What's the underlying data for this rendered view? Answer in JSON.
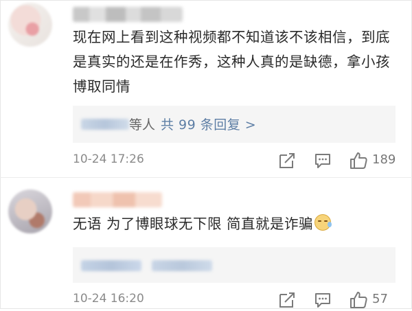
{
  "comments": [
    {
      "text": "现在网上看到这种视频都不知道该不该相信，到底是真实的还是在作秀，这种人真的是缺德，拿小孩博取同情",
      "reply_suffix": "等人",
      "reply_link": "共 99 条回复 >",
      "time": "10-24 17:26",
      "likes": "189",
      "icons": {
        "share": "share-icon",
        "comment": "comment-icon",
        "like": "like-icon"
      }
    },
    {
      "text": "无语 为了博眼球无下限 简直就是诈骗",
      "emoji": "sweat-emoji",
      "time": "10-24 16:20",
      "likes": "57",
      "icons": {
        "share": "share-icon",
        "comment": "comment-icon",
        "like": "like-icon"
      }
    }
  ],
  "colors": {
    "link": "#5d7ea5",
    "meta": "#8a8a8a",
    "reply_bg": "#f5f5f5"
  }
}
